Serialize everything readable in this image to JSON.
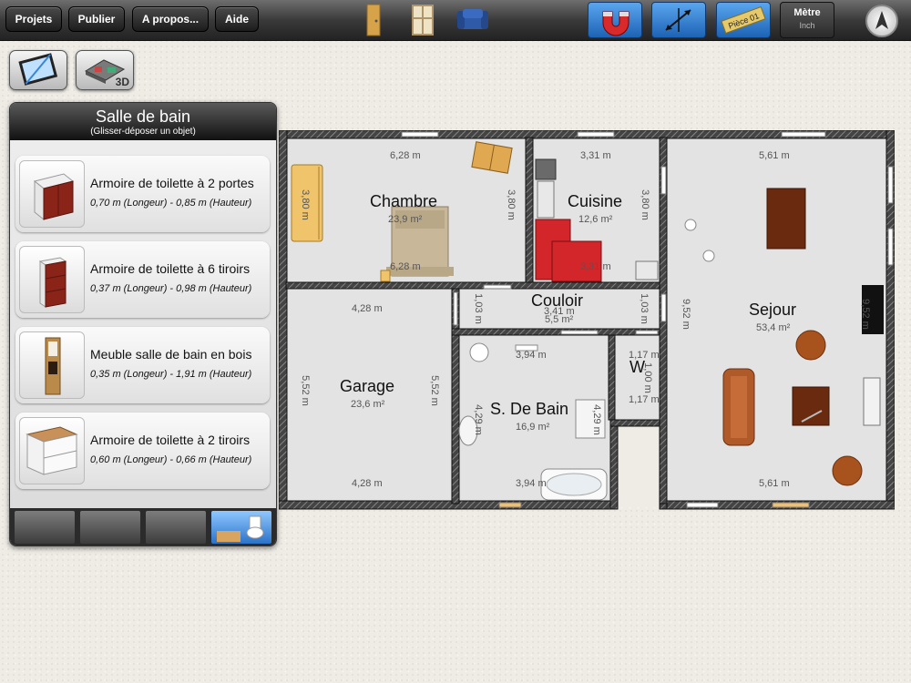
{
  "toolbar": {
    "menu": [
      "Projets",
      "Publier",
      "A propos...",
      "Aide"
    ],
    "room_tag": "Pièce 01",
    "unit_primary": "Mètre",
    "unit_secondary": "Inch"
  },
  "view_buttons": {
    "view3d_label": "3D"
  },
  "panel": {
    "title": "Salle de bain",
    "subtitle": "(Glisser-déposer un objet)",
    "items": [
      {
        "name": "Armoire de toilette à 2 portes",
        "dims": "0,70 m (Longeur) - 0,85 m (Hauteur)"
      },
      {
        "name": "Armoire de toilette à 6 tiroirs",
        "dims": "0,37 m (Longeur) - 0,98 m (Hauteur)"
      },
      {
        "name": "Meuble salle de bain en bois",
        "dims": "0,35 m (Longeur) - 1,91 m (Hauteur)"
      },
      {
        "name": "Armoire de toilette à 2 tiroirs",
        "dims": "0,60 m (Longeur) - 0,66 m (Hauteur)"
      }
    ]
  },
  "plan": {
    "rooms": {
      "chambre": {
        "name": "Chambre",
        "area": "23,9 m²"
      },
      "cuisine": {
        "name": "Cuisine",
        "area": "12,6 m²"
      },
      "sejour": {
        "name": "Sejour",
        "area": "53,4 m²"
      },
      "couloir": {
        "name": "Couloir",
        "area": "5,5 m²"
      },
      "garage": {
        "name": "Garage",
        "area": "23,6 m²"
      },
      "sdb": {
        "name": "S. De Bain",
        "area": "16,9 m²"
      },
      "wc": {
        "name": "W"
      }
    },
    "dims": {
      "chambre_top": "6,28 m",
      "chambre_bottom": "6,28 m",
      "chambre_left": "3,80 m",
      "chambre_right": "3,80 m",
      "cuisine_top": "3,31 m",
      "cuisine_bottom": "3,31 m",
      "cuisine_right": "3,80 m",
      "sejour_top": "5,61 m",
      "sejour_bottom": "5,61 m",
      "sejour_left": "9,52 m",
      "sejour_right": "9,52 m",
      "couloir_left": "1,03 m",
      "couloir_right": "1,03 m",
      "couloir_top": "3,41 m",
      "garage_top": "4,28 m",
      "garage_bottom": "4,28 m",
      "garage_left": "5,52 m",
      "garage_right": "5,52 m",
      "sdb_top": "3,94 m",
      "sdb_bottom": "3,94 m",
      "sdb_left": "4,29 m",
      "sdb_right": "4,29 m",
      "wc_top": "1,17 m",
      "wc_bottom": "1,17 m",
      "wc_mid": "1,00 m"
    }
  }
}
